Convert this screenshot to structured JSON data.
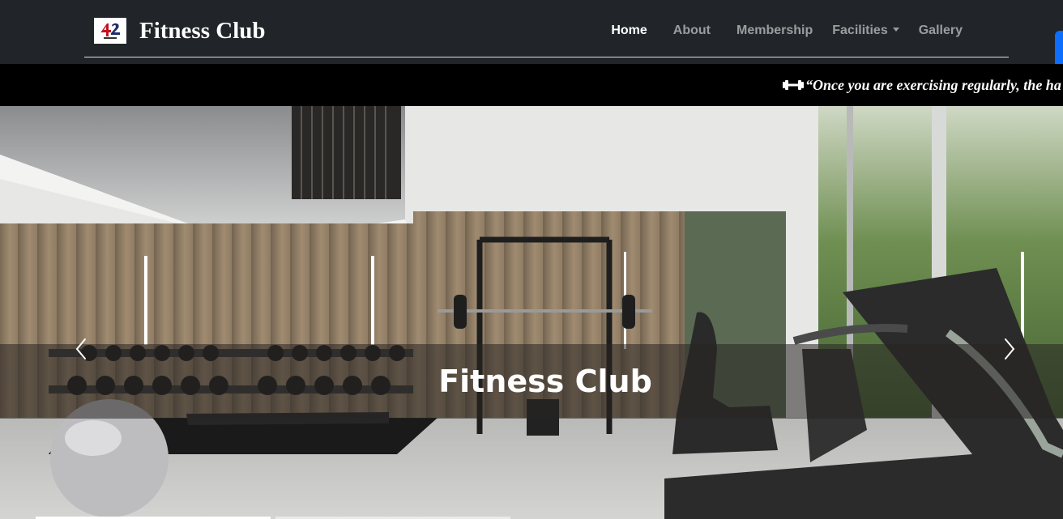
{
  "brand": {
    "name": "Fitness Club",
    "logo_icon": "fitness-club-logo"
  },
  "nav": {
    "items": [
      {
        "label": "Home",
        "active": true
      },
      {
        "label": "About",
        "active": false
      },
      {
        "label": "Membership",
        "active": false
      },
      {
        "label": "Facilities",
        "active": false,
        "dropdown": true
      },
      {
        "label": "Gallery",
        "active": false
      }
    ]
  },
  "marquee": {
    "icon": "dumbbell-icon",
    "text": "“Once you are exercising regularly, the ha"
  },
  "carousel": {
    "caption": "Fitness Club",
    "prev_icon": "chevron-left-icon",
    "next_icon": "chevron-right-icon",
    "active_slide": 0
  },
  "colors": {
    "navbar_bg": "#212529",
    "marquee_bg": "#000000",
    "accent_button": "#0d6efd",
    "active_link": "#ffffff",
    "inactive_link": "rgba(255,255,255,0.55)"
  }
}
